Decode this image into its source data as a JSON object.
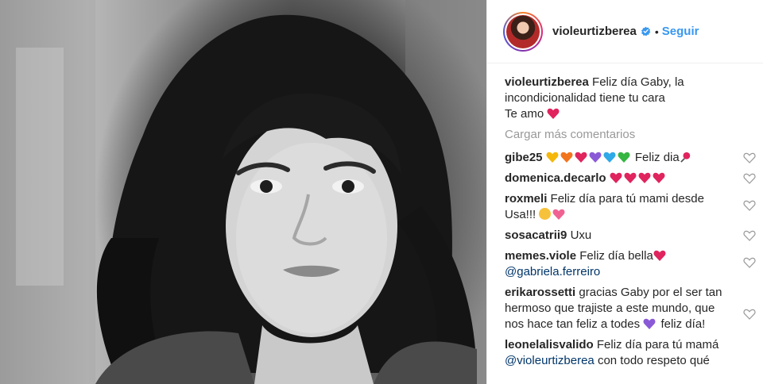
{
  "post": {
    "username": "violeurtizberea",
    "follow_label": "Seguir",
    "separator": "•"
  },
  "caption": {
    "username": "violeurtizberea",
    "line1": "Feliz día Gaby, la incondicionalidad tiene tu cara",
    "line2": "Te amo"
  },
  "load_more_label": "Cargar más comentarios",
  "comments": [
    {
      "username": "gibe25",
      "text_after": "Feliz dia"
    },
    {
      "username": "domenica.decarlo",
      "text_after": ""
    },
    {
      "username": "roxmeli",
      "text": "Feliz día para tú mami desde Usa!!!"
    },
    {
      "username": "sosacatrii9",
      "text": "Uxu"
    },
    {
      "username": "memes.viole",
      "text": "Feliz día bella",
      "mention": "@gabriela.ferreiro"
    },
    {
      "username": "erikarossetti",
      "text": "gracias Gaby por el ser tan hermoso que trajiste a este mundo, que nos hace tan feliz a todes",
      "text_end": "feliz día!"
    },
    {
      "username": "leonelalisvalido",
      "text": "Feliz día para tú mamá",
      "mention": "@violeurtizberea",
      "text_after": "con todo respeto qué"
    }
  ],
  "icons": {
    "verified": "verified-badge-icon",
    "like": "heart-outline-icon",
    "emoji_heart": "red-heart-emoji"
  },
  "colors": {
    "link_blue": "#3897f0",
    "text": "#262626",
    "muted": "#999999",
    "heart_red": "#e0245e",
    "mention_blue": "#003569"
  }
}
